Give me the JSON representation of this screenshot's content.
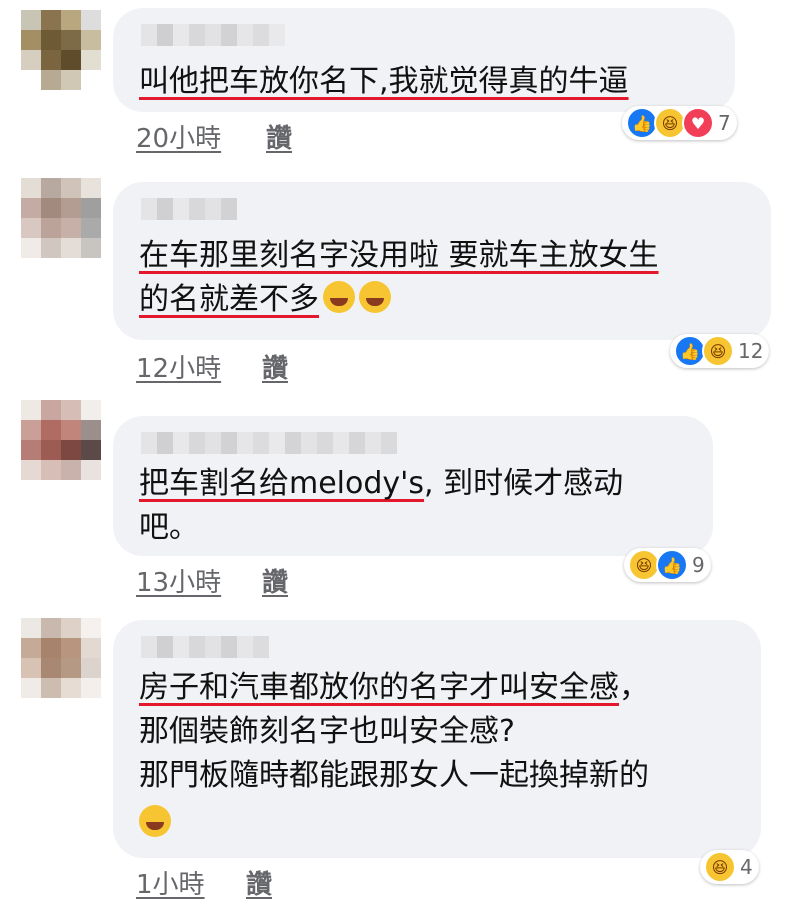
{
  "comments": [
    {
      "lines": [
        {
          "parts": [
            {
              "t": "叫他把车放你名下,我就觉得真的牛逼",
              "ul": true
            }
          ]
        }
      ],
      "time": "20小時",
      "like": "讚",
      "reactions": [
        "like-icon",
        "haha-icon",
        "love-icon"
      ],
      "count": "7"
    },
    {
      "lines": [
        {
          "parts": [
            {
              "t": "在车那里刻名字没用啦 要就车主放女生",
              "ul": true
            }
          ]
        },
        {
          "parts": [
            {
              "t": "的名就差不多",
              "ul": true
            }
          ],
          "emojis": 2
        }
      ],
      "time": "12小時",
      "like": "讚",
      "reactions": [
        "like-icon",
        "haha-icon"
      ],
      "count": "12"
    },
    {
      "lines": [
        {
          "parts": [
            {
              "t": "把车割名给melody's",
              "ul": true
            },
            {
              "t": ", 到时候才感动",
              "ul": false
            }
          ]
        },
        {
          "parts": [
            {
              "t": "吧。",
              "ul": false
            }
          ]
        }
      ],
      "time": "13小時",
      "like": "讚",
      "reactions": [
        "haha-icon",
        "like-icon"
      ],
      "count": "9"
    },
    {
      "lines": [
        {
          "parts": [
            {
              "t": "房子和汽車都放你的名字才叫安全感",
              "ul": true
            },
            {
              "t": "，",
              "ul": false
            }
          ]
        },
        {
          "parts": [
            {
              "t": "那個裝飾刻名字也叫安全感?",
              "ul": false
            }
          ]
        },
        {
          "parts": [
            {
              "t": "那門板隨時都能跟那女人一起換掉新的",
              "ul": false
            }
          ]
        },
        {
          "parts": [],
          "emojis": 1
        }
      ],
      "time": "1小時",
      "like": "讚",
      "reactions": [
        "haha-icon"
      ],
      "count": "4"
    }
  ]
}
